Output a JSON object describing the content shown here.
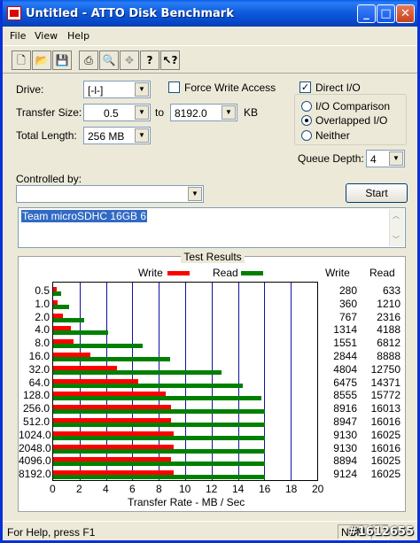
{
  "window": {
    "title": "Untitled - ATTO Disk Benchmark"
  },
  "menu": [
    "File",
    "View",
    "Help"
  ],
  "toolbar": {
    "tools": [
      "new-icon",
      "open-icon",
      "save-icon",
      "print-icon",
      "print-preview-icon",
      "move-icon",
      "help-icon",
      "context-help-icon"
    ]
  },
  "form": {
    "drive_label": "Drive:",
    "drive_value": "[-l-]",
    "force_write_label": "Force Write Access",
    "force_write_checked": false,
    "transfer_size_label": "Transfer Size:",
    "transfer_size_from": "0.5",
    "to_label": "to",
    "transfer_size_to": "8192.0",
    "kb_label": "KB",
    "total_length_label": "Total Length:",
    "total_length_value": "256 MB",
    "direct_io_label": "Direct I/O",
    "direct_io_checked": true,
    "io_mode_options": [
      "I/O Comparison",
      "Overlapped I/O",
      "Neither"
    ],
    "io_mode_selected": "Overlapped I/O",
    "queue_depth_label": "Queue Depth:",
    "queue_depth_value": "4",
    "controlled_by_label": "Controlled by:",
    "controlled_by_value": "",
    "start_button": "Start",
    "description": "Team microSDHC 16GB 6"
  },
  "results": {
    "title": "Test Results",
    "legend_write": "Write",
    "legend_read": "Read",
    "col_write": "Write",
    "col_read": "Read",
    "xlabel": "Transfer Rate - MB / Sec",
    "colors": {
      "write": "#ff0000",
      "read": "#008000"
    }
  },
  "chart_data": {
    "type": "bar",
    "orientation": "horizontal",
    "categories": [
      "0.5",
      "1.0",
      "2.0",
      "4.0",
      "8.0",
      "16.0",
      "32.0",
      "64.0",
      "128.0",
      "256.0",
      "512.0",
      "1024.0",
      "2048.0",
      "4096.0",
      "8192.0"
    ],
    "series": [
      {
        "name": "Write",
        "values": [
          280,
          360,
          767,
          1314,
          1551,
          2844,
          4804,
          6475,
          8555,
          8916,
          8947,
          9130,
          9130,
          8894,
          9124
        ]
      },
      {
        "name": "Read",
        "values": [
          633,
          1210,
          2316,
          4188,
          6812,
          8888,
          12750,
          14371,
          15772,
          16013,
          16016,
          16025,
          16016,
          16025,
          16025
        ]
      }
    ],
    "xlabel": "Transfer Rate - MB / Sec",
    "xticks": [
      "0",
      "2",
      "4",
      "6",
      "8",
      "10",
      "12",
      "14",
      "16",
      "18",
      "20"
    ],
    "xlim": [
      0,
      20
    ],
    "value_unit": "KB/s",
    "grid": true,
    "legend": "top"
  },
  "status": {
    "help_text": "For Help, press F1",
    "num": "NUM",
    "watermark": "#1612655"
  }
}
